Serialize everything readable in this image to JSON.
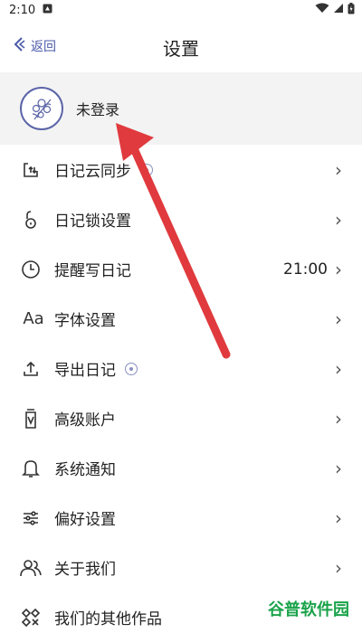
{
  "status_bar": {
    "time": "2:10"
  },
  "nav": {
    "back_label": "返回",
    "title": "设置"
  },
  "login": {
    "label": "未登录"
  },
  "items": [
    {
      "label": "日记云同步",
      "icon": "cloud-sync-icon",
      "badge": true,
      "value": ""
    },
    {
      "label": "日记锁设置",
      "icon": "lock-icon",
      "badge": false,
      "value": ""
    },
    {
      "label": "提醒写日记",
      "icon": "clock-icon",
      "badge": false,
      "value": "21:00"
    },
    {
      "label": "字体设置",
      "icon": "font-icon",
      "badge": false,
      "value": ""
    },
    {
      "label": "导出日记",
      "icon": "export-icon",
      "badge": true,
      "value": ""
    },
    {
      "label": "高级账户",
      "icon": "premium-icon",
      "badge": false,
      "value": ""
    },
    {
      "label": "系统通知",
      "icon": "bell-icon",
      "badge": false,
      "value": ""
    },
    {
      "label": "偏好设置",
      "icon": "sliders-icon",
      "badge": false,
      "value": ""
    },
    {
      "label": "关于我们",
      "icon": "people-icon",
      "badge": false,
      "value": ""
    },
    {
      "label": "我们的其他作品",
      "icon": "apps-icon",
      "badge": false,
      "value": ""
    }
  ],
  "watermark": "谷普软件园",
  "colors": {
    "accent": "#4a5aa8",
    "arrow": "#e03a3e",
    "login_bg": "#f3f3f3"
  }
}
